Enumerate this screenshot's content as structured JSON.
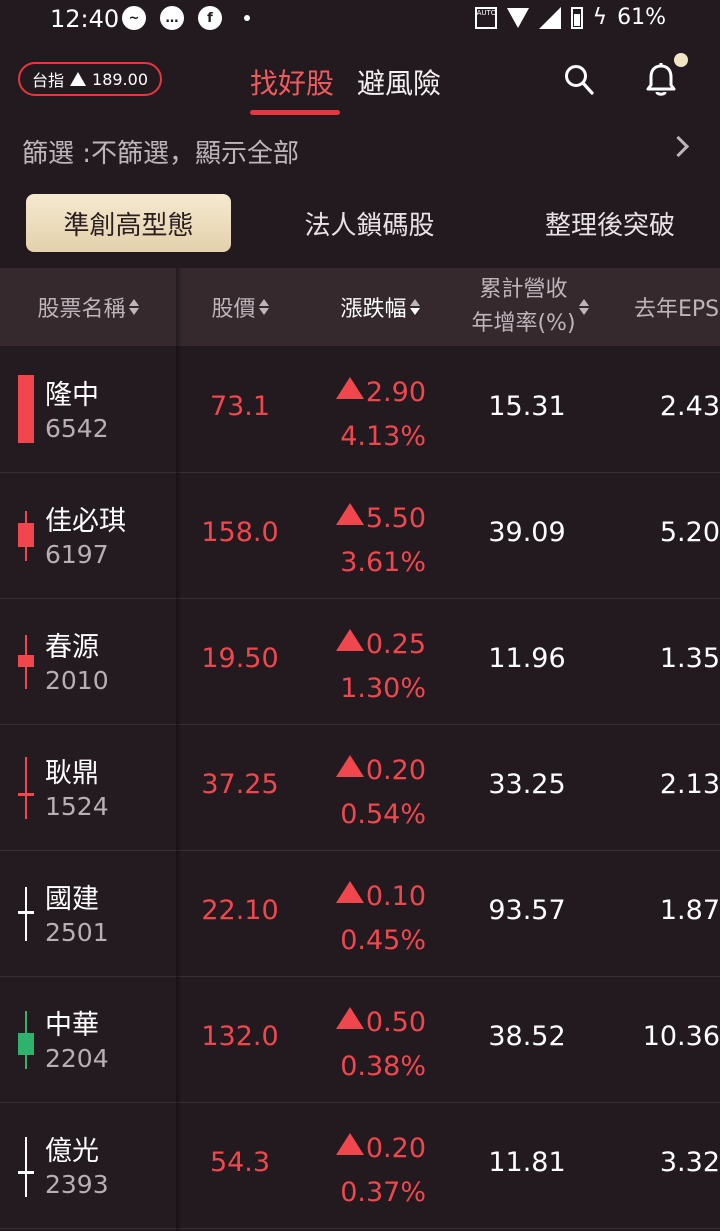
{
  "status_bar": {
    "time": "12:40",
    "battery": "61%",
    "auto_label": "AUTO"
  },
  "header": {
    "index_label": "台指",
    "index_change": "189.00",
    "tabs": [
      {
        "label": "找好股",
        "active": true
      },
      {
        "label": "避風險",
        "active": false
      }
    ]
  },
  "filter": {
    "text": "篩選 :不篩選，顯示全部"
  },
  "chips": [
    {
      "label": "準創高型態",
      "active": true
    },
    {
      "label": "法人鎖碼股",
      "active": false
    },
    {
      "label": "整理後突破",
      "active": false
    }
  ],
  "table": {
    "columns": {
      "name": "股票名稱",
      "price": "股價",
      "change": "漲跌幅",
      "revenue_line1": "累計營收",
      "revenue_line2": "年增率(%)",
      "eps": "去年EPS"
    },
    "rows": [
      {
        "name": "隆中",
        "code": "6542",
        "price": "73.1",
        "change": "2.90",
        "change_pct": "4.13%",
        "revenue_yoy": "15.31",
        "eps": "2.43",
        "candle_color": "red"
      },
      {
        "name": "佳必琪",
        "code": "6197",
        "price": "158.0",
        "change": "5.50",
        "change_pct": "3.61%",
        "revenue_yoy": "39.09",
        "eps": "5.20",
        "candle_color": "red"
      },
      {
        "name": "春源",
        "code": "2010",
        "price": "19.50",
        "change": "0.25",
        "change_pct": "1.30%",
        "revenue_yoy": "11.96",
        "eps": "1.35",
        "candle_color": "red"
      },
      {
        "name": "耿鼎",
        "code": "1524",
        "price": "37.25",
        "change": "0.20",
        "change_pct": "0.54%",
        "revenue_yoy": "33.25",
        "eps": "2.13",
        "candle_color": "red"
      },
      {
        "name": "國建",
        "code": "2501",
        "price": "22.10",
        "change": "0.10",
        "change_pct": "0.45%",
        "revenue_yoy": "93.57",
        "eps": "1.87",
        "candle_color": "white"
      },
      {
        "name": "中華",
        "code": "2204",
        "price": "132.0",
        "change": "0.50",
        "change_pct": "0.38%",
        "revenue_yoy": "38.52",
        "eps": "10.36",
        "candle_color": "green"
      },
      {
        "name": "億光",
        "code": "2393",
        "price": "54.3",
        "change": "0.20",
        "change_pct": "0.37%",
        "revenue_yoy": "11.81",
        "eps": "3.32",
        "candle_color": "white"
      }
    ]
  },
  "colors": {
    "up": "#f0474f",
    "accent": "#e8363f",
    "green": "#2fb36c",
    "chip_bg": "#ecdcb9"
  }
}
